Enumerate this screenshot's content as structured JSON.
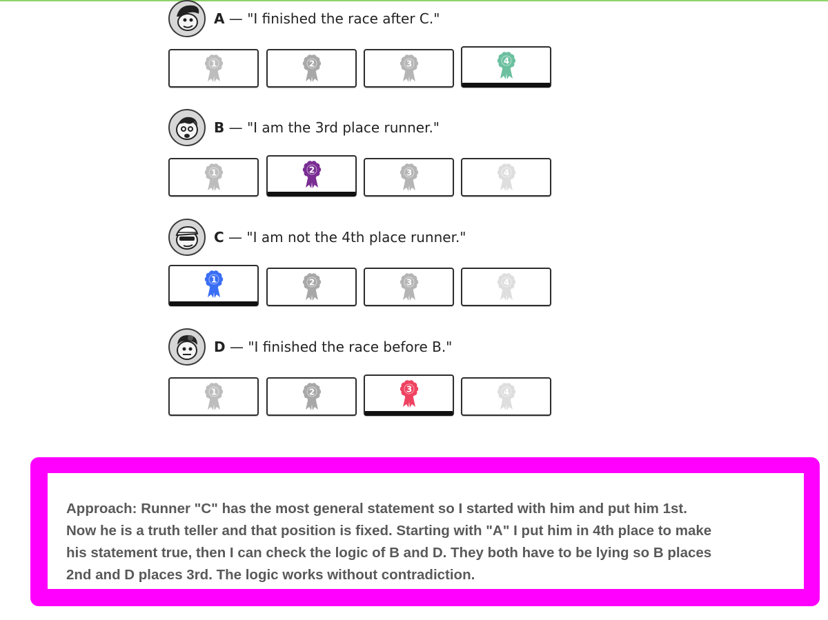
{
  "runners": [
    {
      "letter": "A",
      "statement": " — \"I finished the race after C.\"",
      "selected": 4,
      "accent": "#6cc0a0",
      "options": [
        "1",
        "2",
        "3",
        "4"
      ]
    },
    {
      "letter": "B",
      "statement": " — \"I am the 3rd place runner.\"",
      "selected": 2,
      "accent": "#7a2e93",
      "options": [
        "1",
        "2",
        "3",
        "4"
      ]
    },
    {
      "letter": "C",
      "statement": " — \"I am not the 4th place runner.\"",
      "selected": 1,
      "accent": "#3a6ef5",
      "options": [
        "1",
        "2",
        "3",
        "4"
      ]
    },
    {
      "letter": "D",
      "statement": " — \"I finished the race before B.\"",
      "selected": 3,
      "accent": "#ef4261",
      "options": [
        "1",
        "2",
        "3",
        "4"
      ]
    }
  ],
  "ribbon_greys": [
    "#bdbdbd",
    "#a8a8a8",
    "#b5b5b5",
    "#dedede"
  ],
  "approach": {
    "lines": [
      "Approach:  Runner \"C\" has the most general statement so I started with him and put him 1st.",
      "Now he is a truth teller and that position is fixed. Starting with \"A\" I put him in 4th place to make",
      " his statement true, then I can check the logic of B and D. They both have to be lying so B places",
      "2nd and D places 3rd. The logic works without contradiction."
    ]
  },
  "colors": {
    "frame": "#ff00ff",
    "top_line": "#8fd46a"
  }
}
